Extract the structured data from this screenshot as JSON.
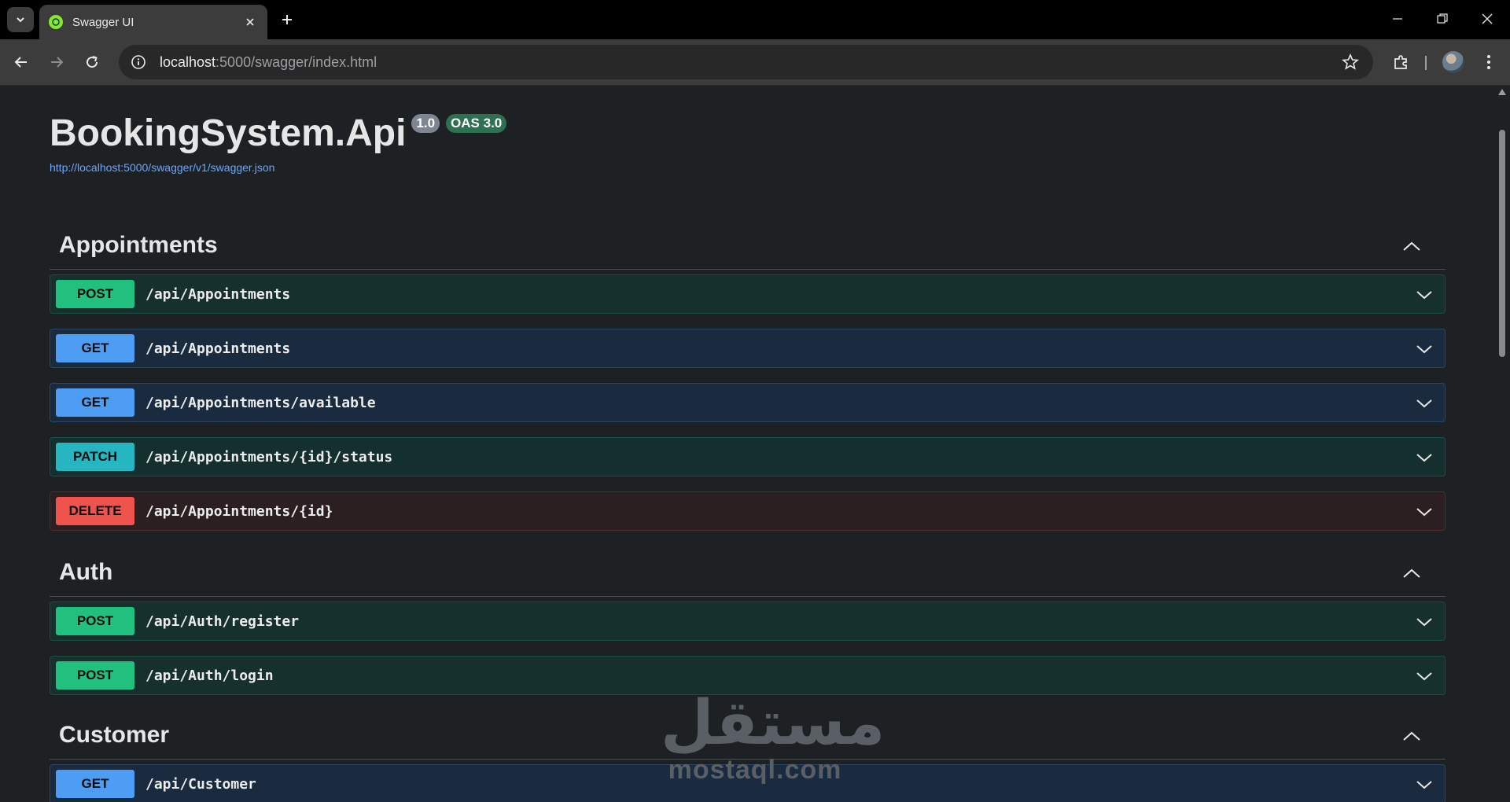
{
  "browser": {
    "tab_title": "Swagger UI",
    "url_host": "localhost",
    "url_rest": ":5000/swagger/index.html"
  },
  "info": {
    "title": "BookingSystem.Api",
    "version": "1.0",
    "oas": "OAS 3.0",
    "spec_url": "http://localhost:5000/swagger/v1/swagger.json"
  },
  "sections": [
    {
      "name": "Appointments",
      "operations": [
        {
          "method": "POST",
          "path": "/api/Appointments"
        },
        {
          "method": "GET",
          "path": "/api/Appointments"
        },
        {
          "method": "GET",
          "path": "/api/Appointments/available"
        },
        {
          "method": "PATCH",
          "path": "/api/Appointments/{id}/status"
        },
        {
          "method": "DELETE",
          "path": "/api/Appointments/{id}"
        }
      ]
    },
    {
      "name": "Auth",
      "operations": [
        {
          "method": "POST",
          "path": "/api/Auth/register"
        },
        {
          "method": "POST",
          "path": "/api/Auth/login"
        }
      ]
    },
    {
      "name": "Customer",
      "operations": [
        {
          "method": "GET",
          "path": "/api/Customer"
        }
      ]
    }
  ],
  "watermark": {
    "arabic": "مستقل",
    "latin": "mostaql.com"
  },
  "colors": {
    "post": "#22c07f",
    "get": "#4d9df5",
    "patch": "#26b6c2",
    "delete": "#f0524d"
  }
}
